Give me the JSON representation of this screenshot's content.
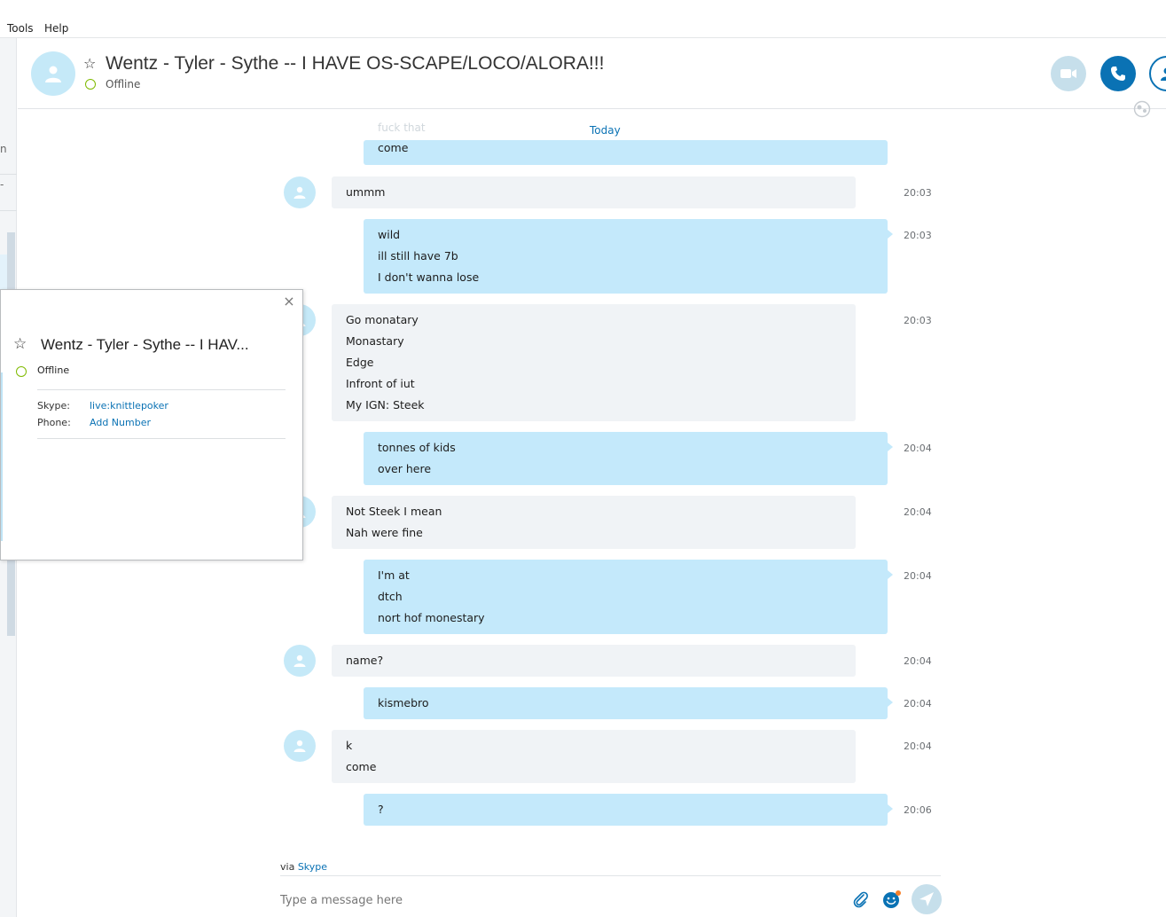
{
  "menu": {
    "tools": "Tools",
    "help": "Help"
  },
  "left_strip": {
    "glyph_top": "n",
    "glyph_bottom": "-"
  },
  "header": {
    "title": "Wentz - Tyler - Sythe -- I HAVE OS-SCAPE/LOCO/ALORA!!!",
    "status": "Offline",
    "icons": {
      "avatar": "person-icon",
      "favorite": "star-outline-icon",
      "video": "video-camera-icon",
      "call": "phone-icon",
      "people": "add-person-icon",
      "globe": "globe-icon"
    }
  },
  "conversation": {
    "date_divider": "Today",
    "faded_partial": "fuck that",
    "partial_out": "come",
    "messages": [
      {
        "dir": "in",
        "lines": [
          "ummm"
        ],
        "time": "20:03",
        "avatar": true
      },
      {
        "dir": "out",
        "lines": [
          "wild",
          "ill still have 7b",
          "I don't wanna lose"
        ],
        "time": "20:03"
      },
      {
        "dir": "in",
        "lines": [
          "Go monatary",
          "Monastary",
          "Edge",
          "Infront of iut",
          "My IGN: Steek"
        ],
        "time": "20:03",
        "avatar": true
      },
      {
        "dir": "out",
        "lines": [
          "tonnes of kids",
          "over here"
        ],
        "time": "20:04"
      },
      {
        "dir": "in",
        "lines": [
          "Not Steek I mean",
          "Nah were fine"
        ],
        "time": "20:04",
        "avatar": true
      },
      {
        "dir": "out",
        "lines": [
          "I'm at",
          "dtch",
          "nort hof monestary"
        ],
        "time": "20:04"
      },
      {
        "dir": "in",
        "lines": [
          "name?"
        ],
        "time": "20:04",
        "avatar": true
      },
      {
        "dir": "out",
        "lines": [
          "kismebro"
        ],
        "time": "20:04"
      },
      {
        "dir": "in",
        "lines": [
          "k",
          "come"
        ],
        "time": "20:04",
        "avatar": true
      },
      {
        "dir": "out",
        "lines": [
          "?"
        ],
        "time": "20:06"
      }
    ]
  },
  "footer": {
    "via_prefix": "via",
    "via_link": "Skype",
    "composer_placeholder": "Type a message here",
    "icons": {
      "attach": "paperclip-icon",
      "emoji": "emoticon-icon",
      "send": "send-icon"
    }
  },
  "popup": {
    "title": "Wentz - Tyler - Sythe -- I HAV...",
    "status": "Offline",
    "close": "×",
    "skype_label": "Skype:",
    "skype_value": "live:knittlepoker",
    "phone_label": "Phone:",
    "phone_value": "Add Number"
  },
  "colors": {
    "accent": "#0a72b4",
    "outgoing_bubble": "#c4e9fb",
    "incoming_bubble": "#f0f3f6",
    "presence_offline": "#7fba00"
  }
}
